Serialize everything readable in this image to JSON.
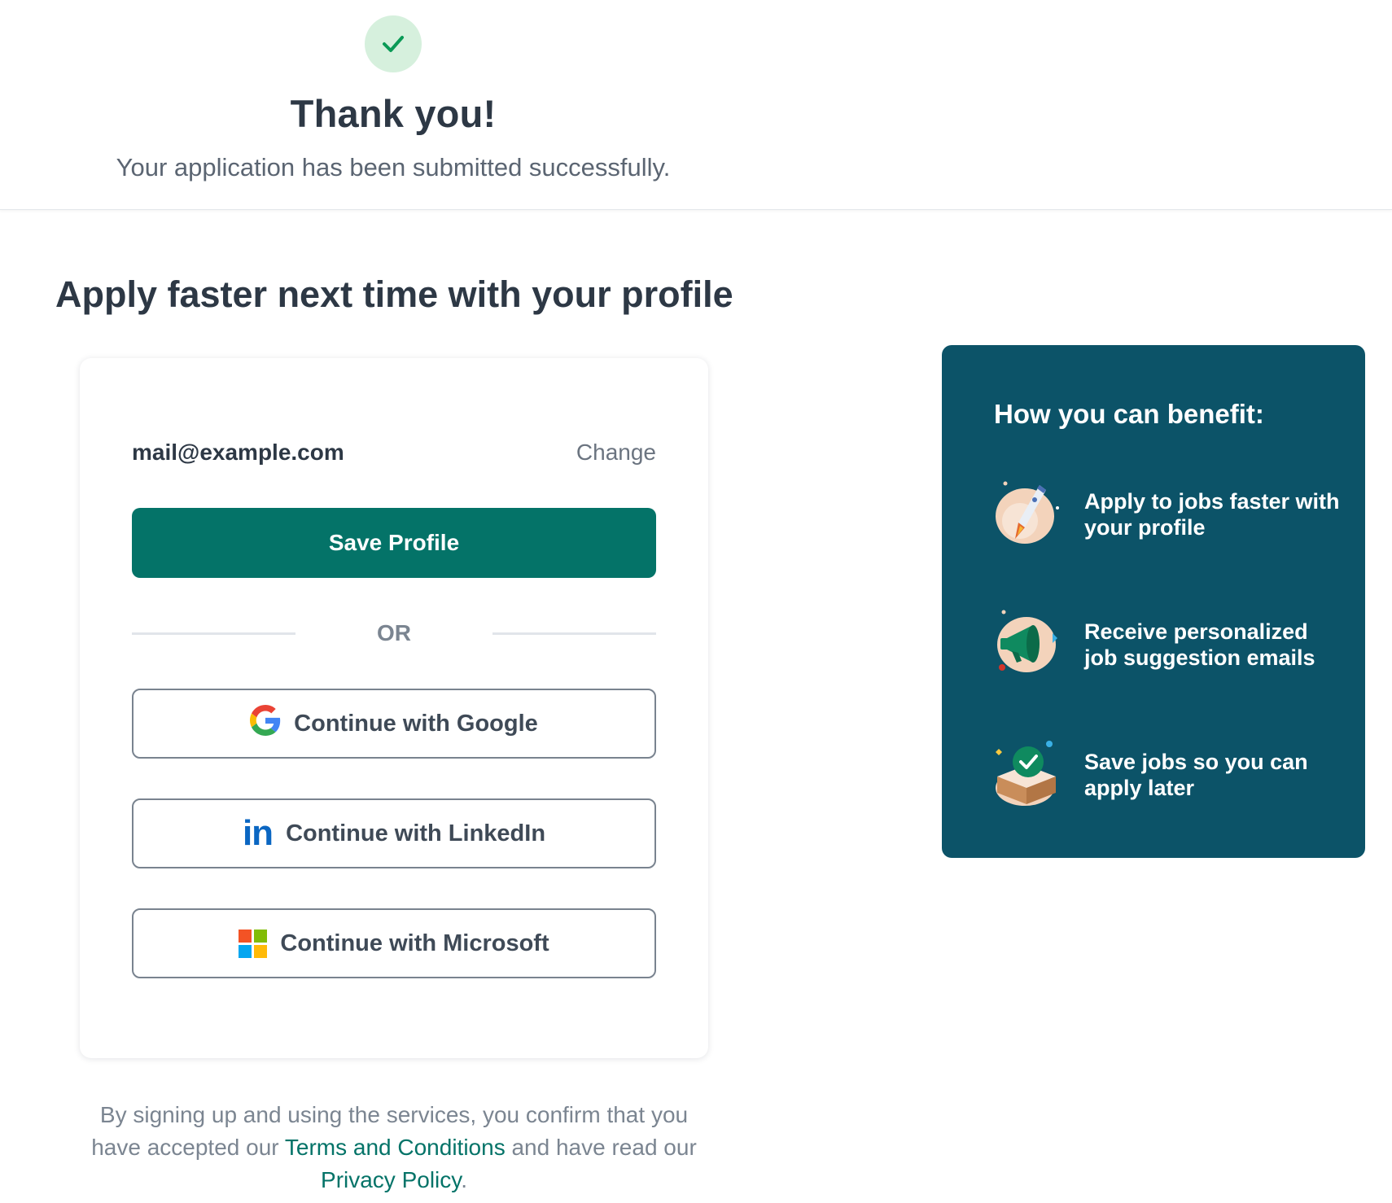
{
  "confirmation": {
    "title": "Thank you!",
    "subtitle": "Your application has been submitted successfully.",
    "icon": "check-icon",
    "icon_bg": "#d6f0dd",
    "icon_color": "#0a9a56"
  },
  "profile_section": {
    "heading": "Apply faster next time with your profile"
  },
  "signup_card": {
    "email": "mail@example.com",
    "change_label": "Change",
    "save_label": "Save Profile",
    "or_label": "OR",
    "google_label": "Continue with Google",
    "linkedin_label": "Continue with LinkedIn",
    "linkedin_glyph": "in",
    "microsoft_label": "Continue with Microsoft"
  },
  "legal": {
    "part1": "By signing up and using the services, you confirm that you have accepted our ",
    "terms_link": "Terms and Conditions",
    "part2": " and have read our ",
    "privacy_link": "Privacy Policy",
    "part3": "."
  },
  "benefits": {
    "title": "How you can benefit:",
    "items": [
      {
        "text": "Apply to jobs faster with your profile",
        "icon": "rocket-icon"
      },
      {
        "text": "Receive personalized job suggestion emails",
        "icon": "megaphone-icon"
      },
      {
        "text": "Save jobs so you can apply later",
        "icon": "saved-box-icon"
      }
    ]
  },
  "colors": {
    "primary": "#047368",
    "panel": "#0c5368",
    "text": "#2d3845",
    "muted": "#7b8591"
  }
}
